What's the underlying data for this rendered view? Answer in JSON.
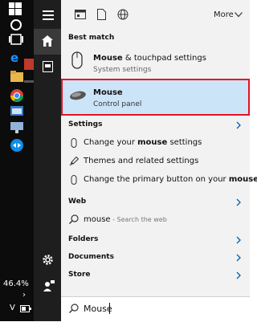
{
  "taskbar": {
    "battery_percent": "46.4%",
    "lang_indicator": "V"
  },
  "top": {
    "more_label": "More"
  },
  "best_match": {
    "header": "Best match",
    "item1_title_bold": "Mouse",
    "item1_title_rest": " & touchpad settings",
    "item1_subtitle": "System settings",
    "item2_title": "Mouse",
    "item2_subtitle": "Control panel"
  },
  "settings": {
    "header": "Settings",
    "rows": [
      {
        "pre": "Change your ",
        "bold": "mouse",
        "post": " settings"
      },
      {
        "pre": "Themes and related settings",
        "bold": "",
        "post": ""
      },
      {
        "pre": "Change the primary button on your ",
        "bold": "mouse",
        "post": ""
      }
    ]
  },
  "web": {
    "header": "Web",
    "query": "mouse",
    "hint": " - Search the web"
  },
  "folders_label": "Folders",
  "documents_label": "Documents",
  "store_label": "Store",
  "search": {
    "value": "Mouse"
  },
  "colors": {
    "accent": "#0063b1",
    "highlight_bg": "#cce4f7",
    "selection_border": "#e81123"
  }
}
